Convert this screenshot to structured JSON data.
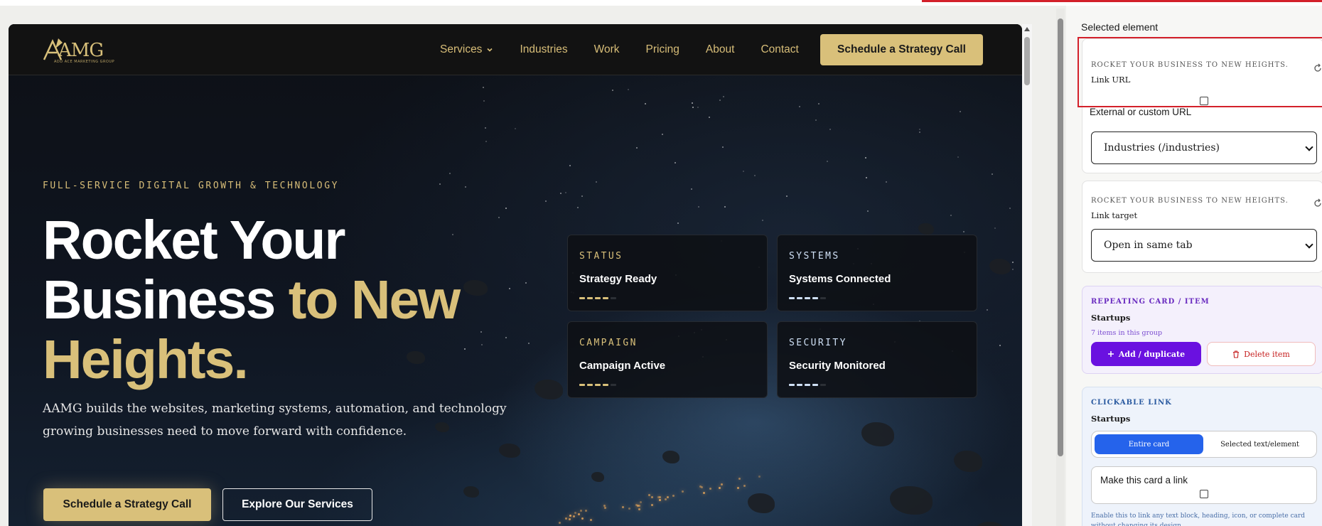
{
  "nav": {
    "logo_text": "AMG",
    "logo_sub": "ADD ACE MARKETING GROUP",
    "links": [
      {
        "label": "Services"
      },
      {
        "label": "Industries"
      },
      {
        "label": "Work"
      },
      {
        "label": "Pricing"
      },
      {
        "label": "About"
      },
      {
        "label": "Contact"
      }
    ],
    "cta": "Schedule a Strategy Call"
  },
  "hero": {
    "eyebrow": "FULL-SERVICE DIGITAL GROWTH & TECHNOLOGY",
    "title_line1": "Rocket Your",
    "title_line2_white": "Business ",
    "title_line2_gold": "to New",
    "title_line3_gold": "Heights.",
    "lede": "AAMG builds the websites, marketing systems, automation, and technology growing businesses need to move forward with confidence.",
    "primary_cta": "Schedule a Strategy Call",
    "secondary_cta": "Explore Our Services"
  },
  "stats": [
    {
      "label": "STATUS",
      "value": "Strategy Ready",
      "accent": "#d9c07a",
      "level": 0.8
    },
    {
      "label": "SYSTEMS",
      "value": "Systems Connected",
      "accent": "#cfe0f5",
      "level": 0.8
    },
    {
      "label": "CAMPAIGN",
      "value": "Campaign Active",
      "accent": "#d9c07a",
      "level": 0.8
    },
    {
      "label": "SECURITY",
      "value": "Security Monitored",
      "accent": "#cfe0f5",
      "level": 0.8
    }
  ],
  "panel": {
    "title": "Selected element",
    "link_url_card": {
      "caption": "ROCKET YOUR BUSINESS TO NEW HEIGHTS.",
      "label": "Link URL",
      "external_label": "External or custom URL",
      "select_value": "Industries (/industries)"
    },
    "link_target_card": {
      "caption": "ROCKET YOUR BUSINESS TO NEW HEIGHTS.",
      "label": "Link target",
      "select_value": "Open in same tab"
    },
    "repeating": {
      "caption": "REPEATING CARD / ITEM",
      "name": "Startups",
      "count": "7 items in this group",
      "add_label": "Add / duplicate",
      "delete_label": "Delete item"
    },
    "clickable": {
      "caption": "CLICKABLE LINK",
      "name": "Startups",
      "seg_on": "Entire card",
      "seg_off": "Selected text/element",
      "make_link_label": "Make this card a link",
      "help": "Enable this to link any text block, heading, icon, or complete card without changing its design."
    }
  },
  "colors": {
    "gold": "#d9c07a",
    "selection_red": "#d3202a",
    "purple": "#6a11e0",
    "blue": "#2563eb"
  }
}
